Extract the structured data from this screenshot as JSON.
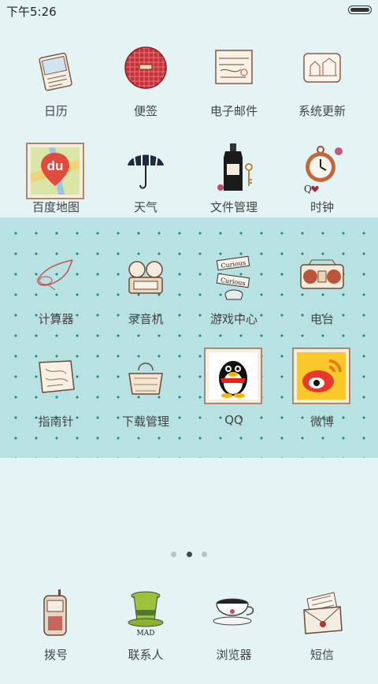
{
  "status_bar": {
    "time": "下午5:26",
    "battery_level": 1.0
  },
  "apps": [
    {
      "label": "日历",
      "icon": "calendar-icon"
    },
    {
      "label": "便签",
      "icon": "notes-icon"
    },
    {
      "label": "电子邮件",
      "icon": "email-icon"
    },
    {
      "label": "系统更新",
      "icon": "system-update-icon"
    },
    {
      "label": "百度地图",
      "icon": "baidu-map-icon",
      "icon_text": "du"
    },
    {
      "label": "天气",
      "icon": "weather-umbrella-icon"
    },
    {
      "label": "文件管理",
      "icon": "file-manager-bottle-icon"
    },
    {
      "label": "时钟",
      "icon": "clock-icon"
    },
    {
      "label": "计算器",
      "icon": "calculator-icon"
    },
    {
      "label": "录音机",
      "icon": "recorder-icon"
    },
    {
      "label": "游戏中心",
      "icon": "game-center-icon"
    },
    {
      "label": "电台",
      "icon": "radio-icon"
    },
    {
      "label": "指南针",
      "icon": "compass-icon"
    },
    {
      "label": "下载管理",
      "icon": "download-manager-icon"
    },
    {
      "label": "QQ",
      "icon": "qq-penguin-icon"
    },
    {
      "label": "微博",
      "icon": "weibo-icon"
    }
  ],
  "page_indicator": {
    "pages": 3,
    "current": 2
  },
  "dock": [
    {
      "label": "拨号",
      "icon": "phone-icon"
    },
    {
      "label": "联系人",
      "icon": "contacts-hat-icon"
    },
    {
      "label": "浏览器",
      "icon": "browser-teacup-icon"
    },
    {
      "label": "短信",
      "icon": "sms-envelope-icon"
    }
  ],
  "colors": {
    "background": "#e4f3f3",
    "dotted_band": "#b8e1e2",
    "dot": "#1f8b80",
    "label": "#444444"
  }
}
